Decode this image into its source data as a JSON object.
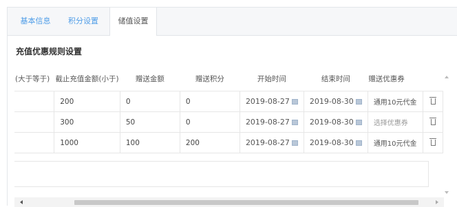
{
  "tabs": [
    {
      "label": "基本信息",
      "active": false
    },
    {
      "label": "积分设置",
      "active": false
    },
    {
      "label": "储值设置",
      "active": true
    }
  ],
  "section_title": "充值优惠规则设置",
  "table": {
    "headers": [
      "(大于等于)",
      "截止充值金额(小于)",
      "赠送金额",
      "赠送积分",
      "开始时间",
      "结束时间",
      "赠送优惠券",
      ""
    ],
    "rows": [
      {
        "end_amount": "200",
        "gift_amount": "0",
        "gift_points": "0",
        "start_date": "2019-08-27",
        "end_date": "2019-08-30",
        "coupon": "通用10元代金",
        "coupon_placeholder": false
      },
      {
        "end_amount": "300",
        "gift_amount": "50",
        "gift_points": "0",
        "start_date": "2019-08-27",
        "end_date": "2019-08-30",
        "coupon": "选择优惠券",
        "coupon_placeholder": true
      },
      {
        "end_amount": "1000",
        "gift_amount": "100",
        "gift_points": "200",
        "start_date": "2019-08-27",
        "end_date": "2019-08-30",
        "coupon": "通用10元代金",
        "coupon_placeholder": false
      }
    ]
  },
  "colors": {
    "tab_link": "#4f9de8",
    "border": "#e6e6e6",
    "scroll_thumb": "#c8c8c8"
  },
  "icons": {
    "calendar": "calendar-icon",
    "delete": "trash-icon"
  }
}
